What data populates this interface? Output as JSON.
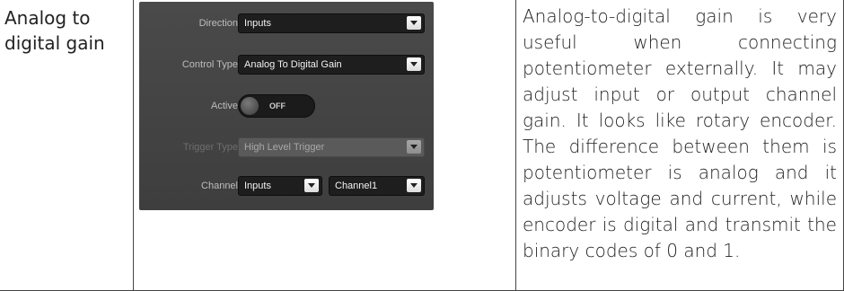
{
  "left_cell": {
    "title": "Analog to digital gain"
  },
  "panel": {
    "direction": {
      "label": "Direction",
      "value": "Inputs"
    },
    "control_type": {
      "label": "Control Type",
      "value": "Analog To Digital Gain"
    },
    "active": {
      "label": "Active",
      "state": "OFF"
    },
    "trigger_type": {
      "label": "Trigger Type",
      "value": "High Level Trigger"
    },
    "channel": {
      "label": "Channel",
      "group": "Inputs",
      "value": "Channel1"
    }
  },
  "description": "Analog-to-digital gain is very useful when connecting potentiometer externally. It may adjust input or output channel gain. It looks like rotary encoder. The difference between them is potentiometer is analog and it adjusts voltage and current, while encoder is digital and transmit  the binary codes of 0 and 1."
}
